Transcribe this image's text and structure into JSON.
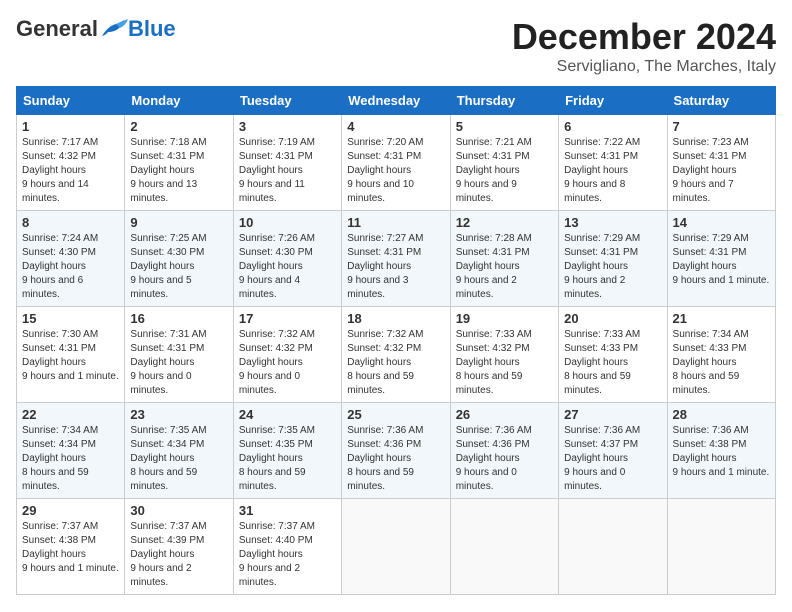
{
  "header": {
    "logo_general": "General",
    "logo_blue": "Blue",
    "month": "December 2024",
    "location": "Servigliano, The Marches, Italy"
  },
  "weekdays": [
    "Sunday",
    "Monday",
    "Tuesday",
    "Wednesday",
    "Thursday",
    "Friday",
    "Saturday"
  ],
  "weeks": [
    [
      {
        "day": "1",
        "sunrise": "7:17 AM",
        "sunset": "4:32 PM",
        "daylight": "9 hours and 14 minutes."
      },
      {
        "day": "2",
        "sunrise": "7:18 AM",
        "sunset": "4:31 PM",
        "daylight": "9 hours and 13 minutes."
      },
      {
        "day": "3",
        "sunrise": "7:19 AM",
        "sunset": "4:31 PM",
        "daylight": "9 hours and 11 minutes."
      },
      {
        "day": "4",
        "sunrise": "7:20 AM",
        "sunset": "4:31 PM",
        "daylight": "9 hours and 10 minutes."
      },
      {
        "day": "5",
        "sunrise": "7:21 AM",
        "sunset": "4:31 PM",
        "daylight": "9 hours and 9 minutes."
      },
      {
        "day": "6",
        "sunrise": "7:22 AM",
        "sunset": "4:31 PM",
        "daylight": "9 hours and 8 minutes."
      },
      {
        "day": "7",
        "sunrise": "7:23 AM",
        "sunset": "4:31 PM",
        "daylight": "9 hours and 7 minutes."
      }
    ],
    [
      {
        "day": "8",
        "sunrise": "7:24 AM",
        "sunset": "4:30 PM",
        "daylight": "9 hours and 6 minutes."
      },
      {
        "day": "9",
        "sunrise": "7:25 AM",
        "sunset": "4:30 PM",
        "daylight": "9 hours and 5 minutes."
      },
      {
        "day": "10",
        "sunrise": "7:26 AM",
        "sunset": "4:30 PM",
        "daylight": "9 hours and 4 minutes."
      },
      {
        "day": "11",
        "sunrise": "7:27 AM",
        "sunset": "4:31 PM",
        "daylight": "9 hours and 3 minutes."
      },
      {
        "day": "12",
        "sunrise": "7:28 AM",
        "sunset": "4:31 PM",
        "daylight": "9 hours and 2 minutes."
      },
      {
        "day": "13",
        "sunrise": "7:29 AM",
        "sunset": "4:31 PM",
        "daylight": "9 hours and 2 minutes."
      },
      {
        "day": "14",
        "sunrise": "7:29 AM",
        "sunset": "4:31 PM",
        "daylight": "9 hours and 1 minute."
      }
    ],
    [
      {
        "day": "15",
        "sunrise": "7:30 AM",
        "sunset": "4:31 PM",
        "daylight": "9 hours and 1 minute."
      },
      {
        "day": "16",
        "sunrise": "7:31 AM",
        "sunset": "4:31 PM",
        "daylight": "9 hours and 0 minutes."
      },
      {
        "day": "17",
        "sunrise": "7:32 AM",
        "sunset": "4:32 PM",
        "daylight": "9 hours and 0 minutes."
      },
      {
        "day": "18",
        "sunrise": "7:32 AM",
        "sunset": "4:32 PM",
        "daylight": "8 hours and 59 minutes."
      },
      {
        "day": "19",
        "sunrise": "7:33 AM",
        "sunset": "4:32 PM",
        "daylight": "8 hours and 59 minutes."
      },
      {
        "day": "20",
        "sunrise": "7:33 AM",
        "sunset": "4:33 PM",
        "daylight": "8 hours and 59 minutes."
      },
      {
        "day": "21",
        "sunrise": "7:34 AM",
        "sunset": "4:33 PM",
        "daylight": "8 hours and 59 minutes."
      }
    ],
    [
      {
        "day": "22",
        "sunrise": "7:34 AM",
        "sunset": "4:34 PM",
        "daylight": "8 hours and 59 minutes."
      },
      {
        "day": "23",
        "sunrise": "7:35 AM",
        "sunset": "4:34 PM",
        "daylight": "8 hours and 59 minutes."
      },
      {
        "day": "24",
        "sunrise": "7:35 AM",
        "sunset": "4:35 PM",
        "daylight": "8 hours and 59 minutes."
      },
      {
        "day": "25",
        "sunrise": "7:36 AM",
        "sunset": "4:36 PM",
        "daylight": "8 hours and 59 minutes."
      },
      {
        "day": "26",
        "sunrise": "7:36 AM",
        "sunset": "4:36 PM",
        "daylight": "9 hours and 0 minutes."
      },
      {
        "day": "27",
        "sunrise": "7:36 AM",
        "sunset": "4:37 PM",
        "daylight": "9 hours and 0 minutes."
      },
      {
        "day": "28",
        "sunrise": "7:36 AM",
        "sunset": "4:38 PM",
        "daylight": "9 hours and 1 minute."
      }
    ],
    [
      {
        "day": "29",
        "sunrise": "7:37 AM",
        "sunset": "4:38 PM",
        "daylight": "9 hours and 1 minute."
      },
      {
        "day": "30",
        "sunrise": "7:37 AM",
        "sunset": "4:39 PM",
        "daylight": "9 hours and 2 minutes."
      },
      {
        "day": "31",
        "sunrise": "7:37 AM",
        "sunset": "4:40 PM",
        "daylight": "9 hours and 2 minutes."
      },
      null,
      null,
      null,
      null
    ]
  ],
  "labels": {
    "sunrise": "Sunrise:",
    "sunset": "Sunset:",
    "daylight": "Daylight hours"
  }
}
